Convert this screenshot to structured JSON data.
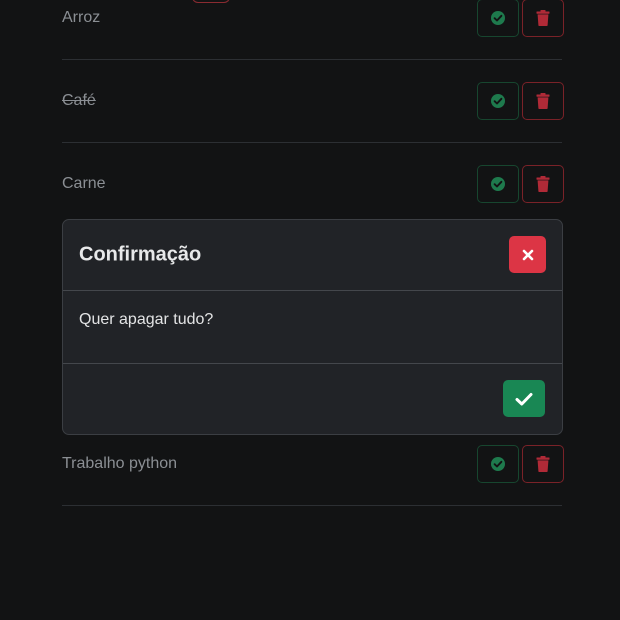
{
  "todo_list": {
    "items": [
      {
        "label": "Arroz",
        "done": false
      },
      {
        "label": "Café",
        "done": true
      },
      {
        "label": "Carne",
        "done": false
      },
      {
        "label": "Trabalho python",
        "done": false
      }
    ]
  },
  "icons": {
    "check": "check-circle-icon",
    "delete": "trash-icon",
    "close": "close-icon",
    "confirm": "check-icon"
  },
  "colors": {
    "success": "#198754",
    "danger": "#dc3545",
    "background": "#121314",
    "modal_background": "#212327"
  },
  "modal": {
    "title": "Confirmação",
    "message": "Quer apagar tudo?"
  }
}
